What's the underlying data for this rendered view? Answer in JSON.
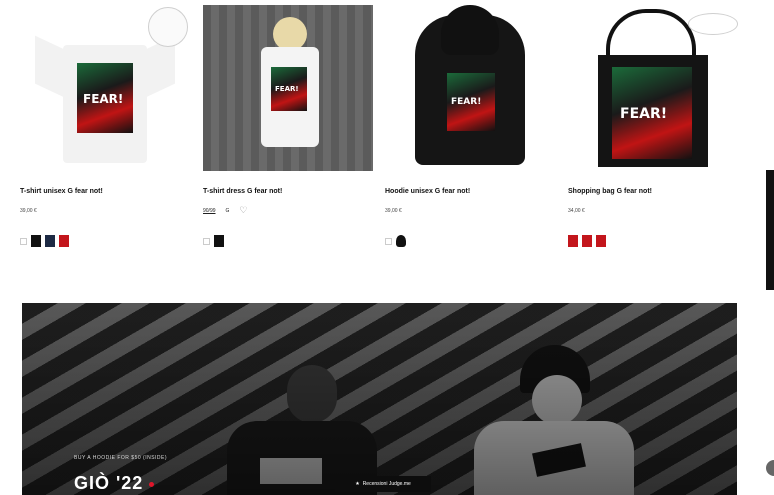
{
  "products": [
    {
      "title": "T-shirt unisex G fear not!",
      "price": "39,00 €",
      "art_text": "FEAR!",
      "swatches": [
        "#ffffff",
        "#111111",
        "#1d2a44",
        "#c3161c"
      ]
    },
    {
      "title": "T-shirt dress G fear not!",
      "price": "",
      "size_chips": [
        "90/99",
        "G"
      ],
      "art_text": "FEAR!",
      "swatches": [
        "#ffffff",
        "#111111"
      ]
    },
    {
      "title": "Hoodie unisex G fear not!",
      "price": "39,00 €",
      "art_text": "FEAR!",
      "swatches": [
        "#ffffff",
        "#111111"
      ]
    },
    {
      "title": "Shopping bag G fear not!",
      "price": "34,00 €",
      "art_text": "FEAR!",
      "swatches": [
        "#c3161c",
        "#c3161c",
        "#c3161c"
      ]
    }
  ],
  "hero": {
    "kicker": "BUY A HOODIE FOR $50 (INSIDE)",
    "headline": "GIÒ '22",
    "review_label": "Recensioni Judge.me",
    "review_icon": "star-icon",
    "accent_color": "#e0162b"
  }
}
